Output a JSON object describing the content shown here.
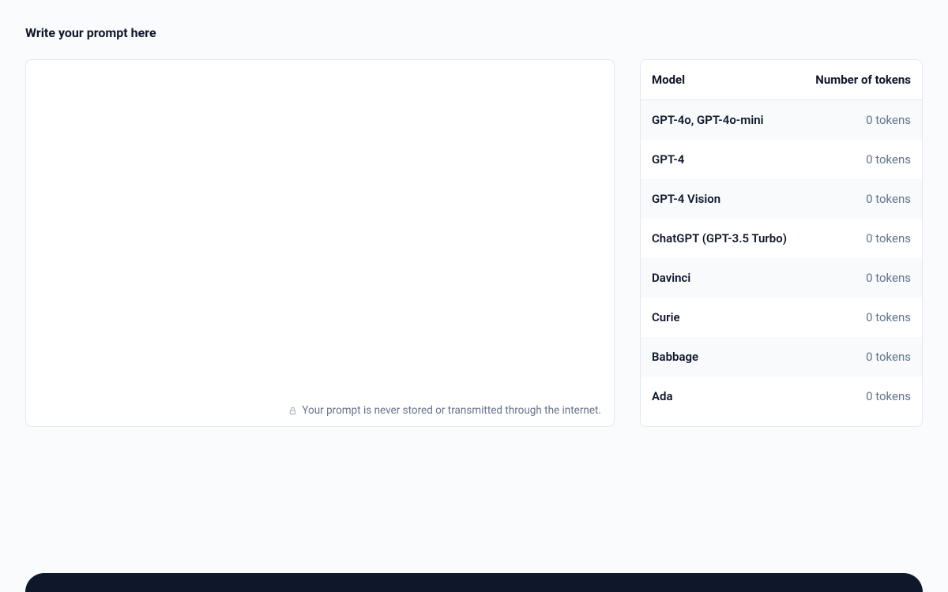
{
  "page": {
    "title": "Write your prompt here"
  },
  "prompt": {
    "value": "",
    "placeholder": ""
  },
  "privacy": {
    "text": "Your prompt is never stored or transmitted through the internet."
  },
  "table": {
    "headers": {
      "model": "Model",
      "tokens": "Number of tokens"
    },
    "rows": [
      {
        "model": "GPT-4o, GPT-4o-mini",
        "tokens": "0 tokens"
      },
      {
        "model": "GPT-4",
        "tokens": "0 tokens"
      },
      {
        "model": "GPT-4 Vision",
        "tokens": "0 tokens"
      },
      {
        "model": "ChatGPT (GPT-3.5 Turbo)",
        "tokens": "0 tokens"
      },
      {
        "model": "Davinci",
        "tokens": "0 tokens"
      },
      {
        "model": "Curie",
        "tokens": "0 tokens"
      },
      {
        "model": "Babbage",
        "tokens": "0 tokens"
      },
      {
        "model": "Ada",
        "tokens": "0 tokens"
      }
    ]
  }
}
